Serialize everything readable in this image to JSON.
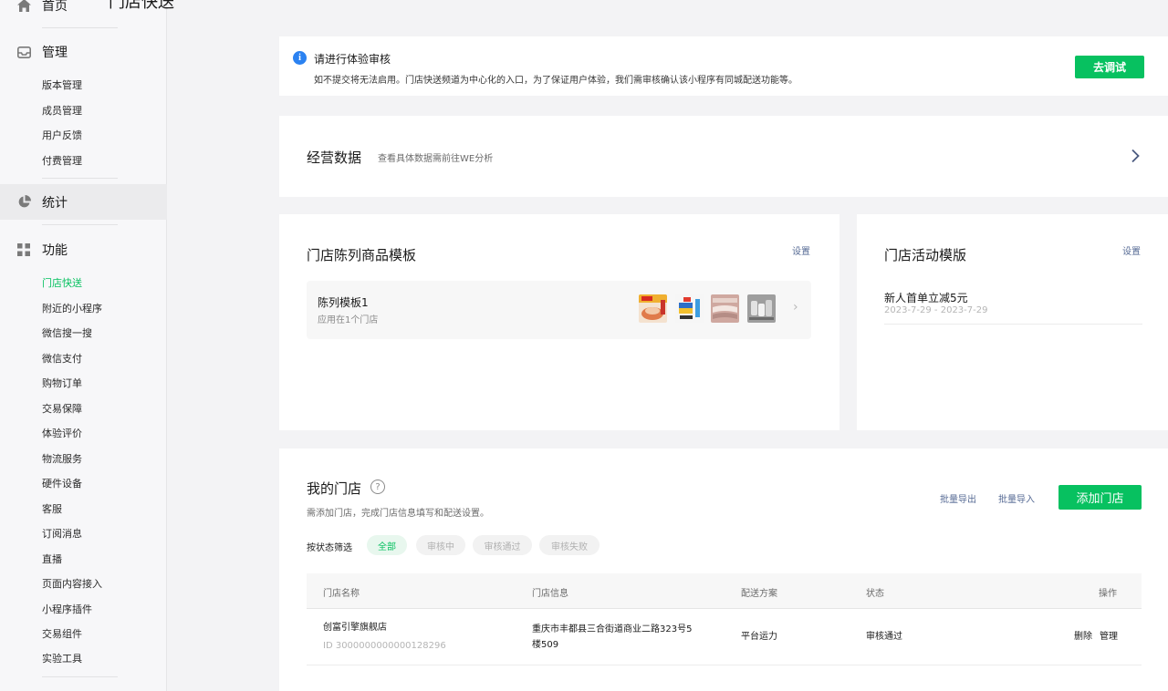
{
  "sidebar": {
    "home": {
      "label": "首页"
    },
    "manage": {
      "label": "管理",
      "items": [
        "版本管理",
        "成员管理",
        "用户反馈",
        "付费管理"
      ]
    },
    "stats": {
      "label": "统计"
    },
    "features": {
      "label": "功能",
      "items": [
        "门店快送",
        "附近的小程序",
        "微信搜一搜",
        "微信支付",
        "购物订单",
        "交易保障",
        "体验评价",
        "物流服务",
        "硬件设备",
        "客服",
        "订阅消息",
        "直播",
        "页面内容接入",
        "小程序插件",
        "交易组件",
        "实验工具"
      ],
      "current": "门店快送"
    }
  },
  "page": {
    "title": "门店快送"
  },
  "notice": {
    "title": "请进行体验审核",
    "desc": "如不提交将无法启用。门店快送频道为中心化的入口，为了保证用户体验，我们需审核确认该小程序有同城配送功能等。",
    "button": "去调试"
  },
  "business": {
    "title": "经营数据",
    "subtitle": "查看具体数据需前往WE分析"
  },
  "template": {
    "title": "门店陈列商品模板",
    "settings": "设置",
    "item": {
      "name": "陈列模板1",
      "sub": "应用在1个门店"
    }
  },
  "activity": {
    "title": "门店活动模版",
    "settings": "设置",
    "item": {
      "name": "新人首单立减5元",
      "date": "2023-7-29 - 2023-7-29"
    }
  },
  "stores": {
    "title": "我的门店",
    "subtitle": "需添加门店，完成门店信息填写和配送设置。",
    "export": "批量导出",
    "import": "批量导入",
    "add": "添加门店",
    "filter_label": "按状态筛选",
    "filters": [
      "全部",
      "审核中",
      "审核通过",
      "审核失败"
    ],
    "columns": [
      "门店名称",
      "门店信息",
      "配送方案",
      "状态",
      "操作"
    ],
    "rows": [
      {
        "name": "创富引擎旗舰店",
        "id": "ID 3000000000000128296",
        "address": "重庆市丰都县三合街道商业二路323号5楼509",
        "address_line1": "重庆市丰都县三合街道商业二路323号5",
        "address_line2": "楼509",
        "delivery": "平台运力",
        "status": "审核通过",
        "delete": "删除",
        "manage": "管理"
      }
    ]
  },
  "colors": {
    "accent": "#07c160",
    "link": "#576b95",
    "info": "#2b82f1"
  }
}
